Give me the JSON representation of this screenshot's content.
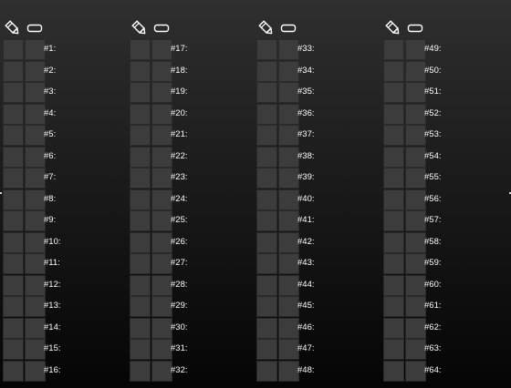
{
  "toolbar": {
    "pencil_icon": "pencil-icon",
    "eraser_icon": "eraser-icon"
  },
  "panels": [
    {
      "rows": [
        "#1:",
        "#2:",
        "#3:",
        "#4:",
        "#5:",
        "#6:",
        "#7:",
        "#8:",
        "#9:",
        "#10:",
        "#11:",
        "#12:",
        "#13:",
        "#14:",
        "#15:",
        "#16:"
      ]
    },
    {
      "rows": [
        "#17:",
        "#18:",
        "#19:",
        "#20:",
        "#21:",
        "#22:",
        "#23:",
        "#24:",
        "#25:",
        "#26:",
        "#27:",
        "#28:",
        "#29:",
        "#30:",
        "#31:",
        "#32:"
      ]
    },
    {
      "rows": [
        "#33:",
        "#34:",
        "#35:",
        "#36:",
        "#37:",
        "#38:",
        "#39:",
        "#40:",
        "#41:",
        "#42:",
        "#43:",
        "#44:",
        "#45:",
        "#46:",
        "#47:",
        "#48:"
      ]
    },
    {
      "rows": [
        "#49:",
        "#50:",
        "#51:",
        "#52:",
        "#53:",
        "#54:",
        "#55:",
        "#56:",
        "#57:",
        "#58:",
        "#59:",
        "#60:",
        "#61:",
        "#62:",
        "#63:",
        "#64:"
      ]
    }
  ],
  "colors": {
    "cell": "#3c3c3c",
    "cell_border": "#2a2a2a",
    "label": "#ffffff",
    "background_top": "#2f2f2f",
    "background_bottom": "#050505"
  }
}
